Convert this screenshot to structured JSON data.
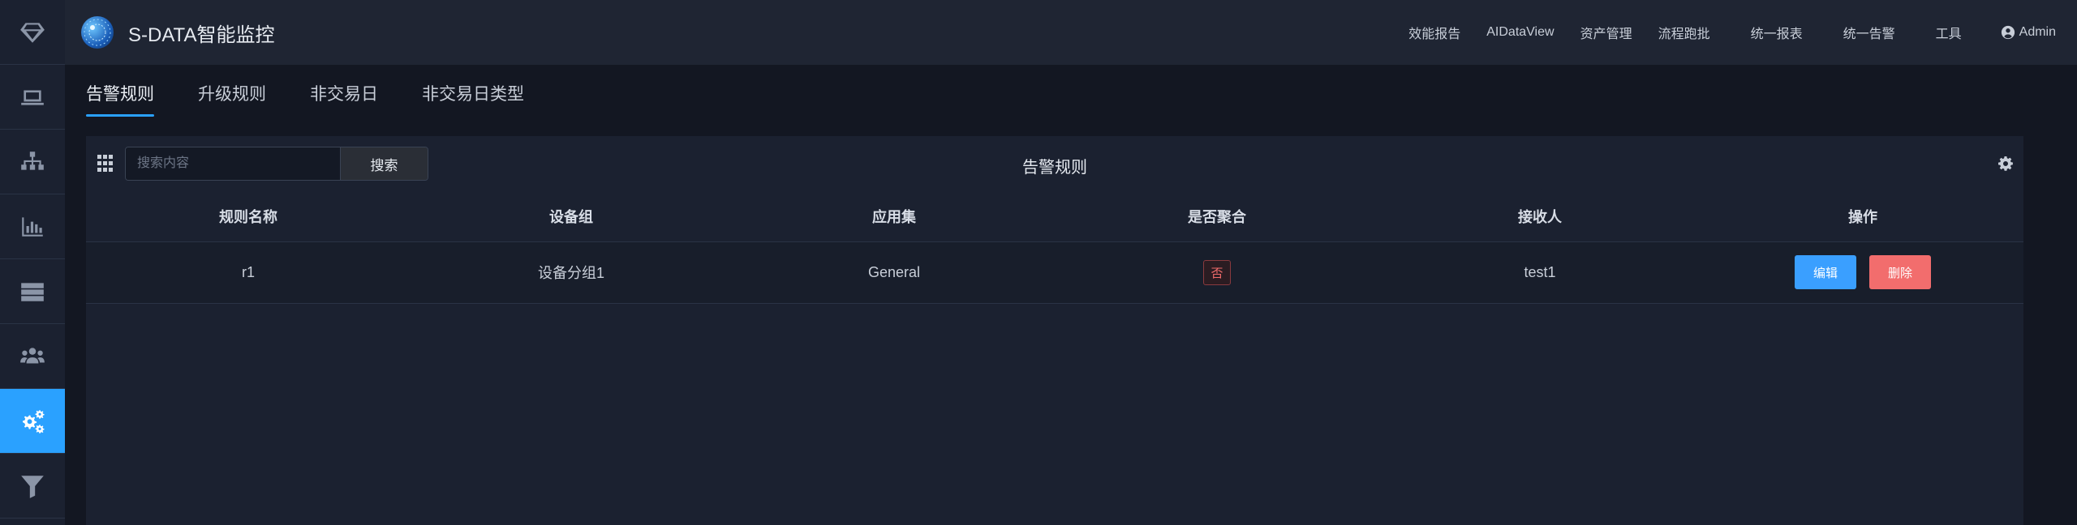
{
  "app": {
    "title": "S-DATA智能监控"
  },
  "sidebar": {
    "items": [
      {
        "icon": "diamond-icon"
      },
      {
        "icon": "laptop-icon"
      },
      {
        "icon": "sitemap-icon"
      },
      {
        "icon": "bar-chart-icon"
      },
      {
        "icon": "server-icon"
      },
      {
        "icon": "users-icon"
      },
      {
        "icon": "cogs-icon",
        "active": true
      },
      {
        "icon": "filter-icon"
      }
    ]
  },
  "topnav": {
    "items": [
      "效能报告",
      "AIDataView",
      "资产管理",
      "流程跑批",
      "统一报表",
      "统一告警",
      "工具"
    ],
    "user": "Admin"
  },
  "tabs": [
    {
      "label": "告警规则",
      "active": true
    },
    {
      "label": "升级规则"
    },
    {
      "label": "非交易日"
    },
    {
      "label": "非交易日类型"
    }
  ],
  "panel": {
    "title": "告警规则",
    "search_placeholder": "搜索内容",
    "search_button": "搜索"
  },
  "table": {
    "columns": [
      "规则名称",
      "设备组",
      "应用集",
      "是否聚合",
      "接收人",
      "操作"
    ],
    "rows": [
      {
        "name": "r1",
        "device_group": "设备分组1",
        "app_set": "General",
        "aggregate": "否",
        "receiver": "test1",
        "edit": "编辑",
        "delete": "删除"
      }
    ]
  },
  "colors": {
    "accent": "#2aa1ff",
    "danger": "#f26d6d",
    "background": "#131722"
  }
}
